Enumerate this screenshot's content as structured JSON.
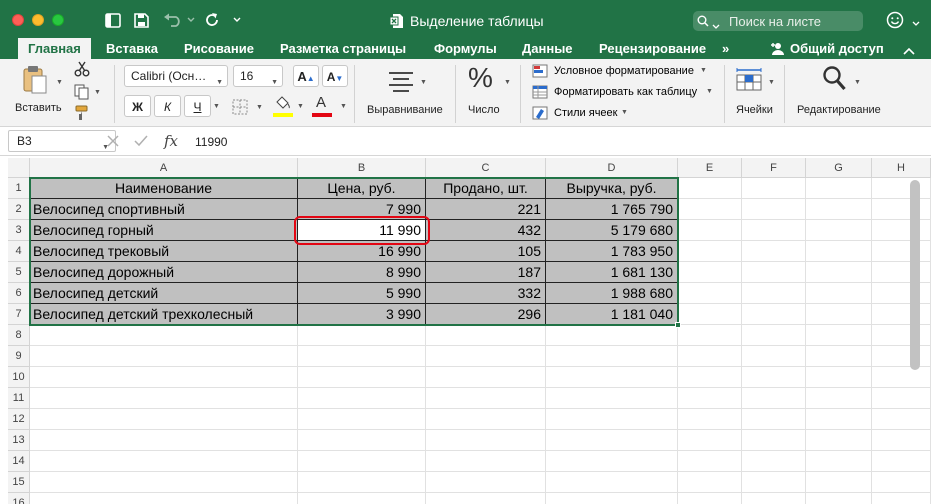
{
  "window": {
    "title": "Выделение таблицы",
    "search_placeholder": "Поиск на листе"
  },
  "tabs": [
    "Главная",
    "Вставка",
    "Рисование",
    "Разметка страницы",
    "Формулы",
    "Данные",
    "Рецензирование"
  ],
  "tabs_more": "»",
  "share_label": "Общий доступ",
  "ribbon": {
    "paste_label": "Вставить",
    "font_name": "Calibri (Осн…",
    "font_size": "16",
    "bold": "Ж",
    "italic": "К",
    "underline": "Ч",
    "align_label": "Выравнивание",
    "number_label": "Число",
    "number_symbol": "%",
    "cond_format": "Условное форматирование",
    "format_table": "Форматировать как таблицу",
    "cell_styles": "Стили ячеек",
    "cells_label": "Ячейки",
    "editing_label": "Редактирование"
  },
  "formula_bar": {
    "name_box": "B3",
    "fx": "fx",
    "value": "11990"
  },
  "colors": {
    "accent": "#217346",
    "table_fill": "#c0c0c0",
    "highlight": "#e30613",
    "fill_swatch": "#ffff00",
    "font_swatch": "#e30613"
  },
  "sheet": {
    "columns": [
      "A",
      "B",
      "C",
      "D",
      "E",
      "F",
      "G",
      "H"
    ],
    "rows": [
      "1",
      "2",
      "3",
      "4",
      "5",
      "6",
      "7",
      "8",
      "9",
      "10",
      "11",
      "12",
      "13",
      "14",
      "15",
      "16"
    ],
    "headers": [
      "Наименование",
      "Цена, руб.",
      "Продано, шт.",
      "Выручка, руб."
    ],
    "data": [
      [
        "Велосипед спортивный",
        "7 990",
        "221",
        "1 765 790"
      ],
      [
        "Велосипед горный",
        "11 990",
        "432",
        "5 179 680"
      ],
      [
        "Велосипед трековый",
        "16 990",
        "105",
        "1 783 950"
      ],
      [
        "Велосипед дорожный",
        "8 990",
        "187",
        "1 681 130"
      ],
      [
        "Велосипед детский",
        "5 990",
        "332",
        "1 988 680"
      ],
      [
        "Велосипед детский трехколесный",
        "3 990",
        "296",
        "1 181 040"
      ]
    ]
  }
}
